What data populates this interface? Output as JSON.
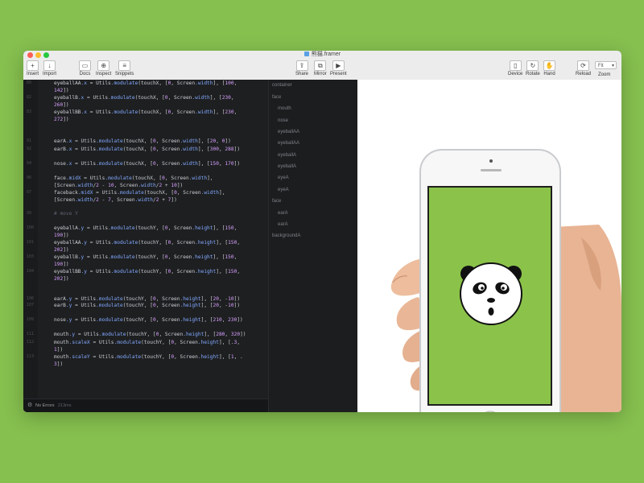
{
  "window": {
    "title": "熊猫.framer"
  },
  "toolbar": {
    "insert": {
      "icon": "+",
      "label": "Insert"
    },
    "import": {
      "icon": "↓",
      "label": "Import"
    },
    "docs": {
      "icon": "▭",
      "label": "Docs"
    },
    "inspect": {
      "icon": "⊕",
      "label": "Inspect"
    },
    "snippets": {
      "icon": "≡",
      "label": "Snippets"
    },
    "share": {
      "icon": "⇪",
      "label": "Share"
    },
    "mirror": {
      "icon": "⧉",
      "label": "Mirror"
    },
    "present": {
      "icon": "▶",
      "label": "Present"
    },
    "device": {
      "icon": "▯",
      "label": "Device"
    },
    "rotate": {
      "icon": "↻",
      "label": "Rotate"
    },
    "hand": {
      "icon": "✋",
      "label": "Hand"
    },
    "reload": {
      "icon": "⟳",
      "label": "Reload"
    },
    "zoom": {
      "value": "Fit",
      "label": "Zoom"
    }
  },
  "code": {
    "lines": [
      {
        "n": "80",
        "text": "eyeballAA.x = Utils.modulate(touchX, [0, Screen.width], [100,",
        "cont": "142])"
      },
      {
        "n": "82",
        "text": "eyeballB.x = Utils.modulate(touchX, [0, Screen.width], [230,",
        "cont": "260])"
      },
      {
        "n": "83",
        "text": "eyeballBB.x = Utils.modulate(touchX, [0, Screen.width], [230,",
        "cont": "272])"
      },
      {
        "n": "91",
        "text": "earA.x = Utils.modulate(touchX, [0, Screen.width], [20, 0])"
      },
      {
        "n": "92",
        "text": "earB.x = Utils.modulate(touchX, [0, Screen.width], [300, 288])"
      },
      {
        "n": "94",
        "text": "nose.x = Utils.modulate(touchX, [0, Screen.width], [150, 170])"
      },
      {
        "n": "96",
        "text": "face.midX = Utils.modulate(touchX, [0, Screen.width],",
        "cont": "[Screen.width/2 - 10, Screen.width/2 + 10])"
      },
      {
        "n": "97",
        "text": "faceback.midX = Utils.modulate(touchX, [0, Screen.width],",
        "cont": "[Screen.width/2 - 7, Screen.width/2 + 7])"
      },
      {
        "n": "99",
        "text": "# move Y"
      },
      {
        "n": "100",
        "text": "eyeballA.y = Utils.modulate(touchY, [0, Screen.height], [150,",
        "cont": "190])"
      },
      {
        "n": "101",
        "text": "eyeballAA.y = Utils.modulate(touchY, [0, Screen.height], [150,",
        "cont": "202])"
      },
      {
        "n": "103",
        "text": "eyeballB.y = Utils.modulate(touchY, [0, Screen.height], [150,",
        "cont": "190])"
      },
      {
        "n": "104",
        "text": "eyeballBB.y = Utils.modulate(touchY, [0, Screen.height], [150,",
        "cont": "202])"
      },
      {
        "n": "106",
        "text": "earA.y = Utils.modulate(touchY, [0, Screen.height], [20, -10])"
      },
      {
        "n": "107",
        "text": "earB.y = Utils.modulate(touchY, [0, Screen.height], [20, -10])"
      },
      {
        "n": "109",
        "text": "nose.y = Utils.modulate(touchY, [0, Screen.height], [210, 230])"
      },
      {
        "n": "111",
        "text": "mouth.y = Utils.modulate(touchY, [0, Screen.height], [280, 320])"
      },
      {
        "n": "112",
        "text": "mouth.scaleX = Utils.modulate(touchY, [0, Screen.height], [.3,",
        "cont": "1])"
      },
      {
        "n": "113",
        "text": "mouth.scaleY = Utils.modulate(touchY, [0, Screen.height], [1, .",
        "cont": "3])"
      }
    ]
  },
  "status": {
    "text": "No Errors",
    "time": "213ms"
  },
  "layers": [
    {
      "name": "container"
    },
    {
      "name": "face"
    },
    {
      "name": "mouth"
    },
    {
      "name": "nose"
    },
    {
      "name": "eyeballAA"
    },
    {
      "name": "eyeballAA"
    },
    {
      "name": "eyeballA"
    },
    {
      "name": "eyeballA"
    },
    {
      "name": "eyeA"
    },
    {
      "name": "eyeA"
    },
    {
      "name": "face"
    },
    {
      "name": "earA"
    },
    {
      "name": "earA"
    },
    {
      "name": "backgroundA"
    }
  ],
  "colors": {
    "background": "#86c04f",
    "screen": "#8bc34a"
  }
}
